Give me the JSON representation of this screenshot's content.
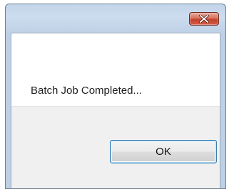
{
  "dialog": {
    "message": "Batch Job Completed...",
    "ok_label": "OK",
    "close_icon": "close-icon"
  }
}
